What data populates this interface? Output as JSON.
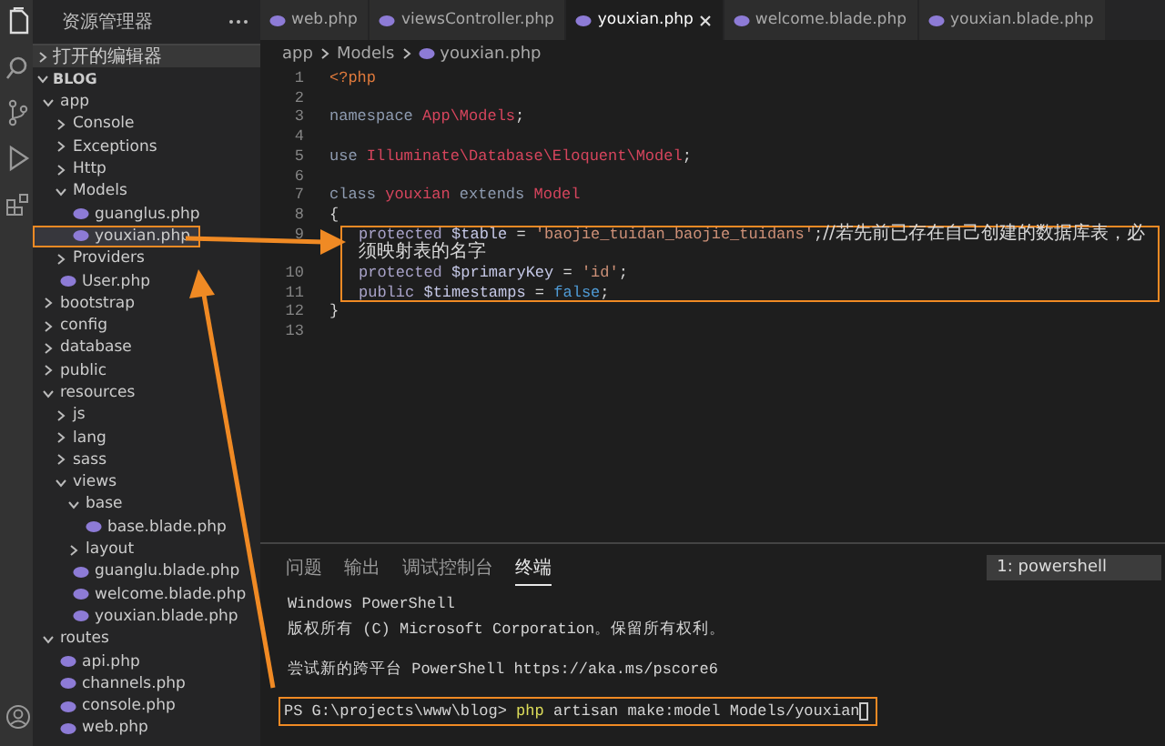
{
  "sidebar": {
    "title": "资源管理器",
    "sections": [
      {
        "label": "打开的编辑器",
        "expanded": false
      }
    ],
    "tree": {
      "label": "BLOG",
      "expanded": true,
      "children": [
        {
          "label": "app",
          "kind": "folder",
          "expanded": true,
          "selected": false,
          "highlighted": false,
          "children": [
            {
              "label": "Console",
              "kind": "folder",
              "expanded": false,
              "selected": false,
              "highlighted": false
            },
            {
              "label": "Exceptions",
              "kind": "folder",
              "expanded": false,
              "selected": false,
              "highlighted": false
            },
            {
              "label": "Http",
              "kind": "folder",
              "expanded": false,
              "selected": false,
              "highlighted": false
            },
            {
              "label": "Models",
              "kind": "folder",
              "expanded": true,
              "selected": false,
              "highlighted": false,
              "children": [
                {
                  "label": "guanglus.php",
                  "kind": "file",
                  "selected": false,
                  "highlighted": false
                },
                {
                  "label": "youxian.php",
                  "kind": "file",
                  "selected": true,
                  "highlighted": true
                }
              ]
            },
            {
              "label": "Providers",
              "kind": "folder",
              "expanded": false,
              "selected": false,
              "highlighted": false
            },
            {
              "label": "User.php",
              "kind": "file",
              "selected": false,
              "highlighted": false
            }
          ]
        },
        {
          "label": "bootstrap",
          "kind": "folder",
          "expanded": false,
          "selected": false,
          "highlighted": false
        },
        {
          "label": "config",
          "kind": "folder",
          "expanded": false,
          "selected": false,
          "highlighted": false
        },
        {
          "label": "database",
          "kind": "folder",
          "expanded": false,
          "selected": false,
          "highlighted": false
        },
        {
          "label": "public",
          "kind": "folder",
          "expanded": false,
          "selected": false,
          "highlighted": false
        },
        {
          "label": "resources",
          "kind": "folder",
          "expanded": true,
          "selected": false,
          "highlighted": false,
          "children": [
            {
              "label": "js",
              "kind": "folder",
              "expanded": false,
              "selected": false,
              "highlighted": false
            },
            {
              "label": "lang",
              "kind": "folder",
              "expanded": false,
              "selected": false,
              "highlighted": false
            },
            {
              "label": "sass",
              "kind": "folder",
              "expanded": false,
              "selected": false,
              "highlighted": false
            },
            {
              "label": "views",
              "kind": "folder",
              "expanded": true,
              "selected": false,
              "highlighted": false,
              "children": [
                {
                  "label": "base",
                  "kind": "folder",
                  "expanded": true,
                  "selected": false,
                  "highlighted": false,
                  "children": [
                    {
                      "label": "base.blade.php",
                      "kind": "file",
                      "selected": false,
                      "highlighted": false
                    }
                  ]
                },
                {
                  "label": "layout",
                  "kind": "folder",
                  "expanded": false,
                  "selected": false,
                  "highlighted": false
                },
                {
                  "label": "guanglu.blade.php",
                  "kind": "file",
                  "selected": false,
                  "highlighted": false
                },
                {
                  "label": "welcome.blade.php",
                  "kind": "file",
                  "selected": false,
                  "highlighted": false
                },
                {
                  "label": "youxian.blade.php",
                  "kind": "file",
                  "selected": false,
                  "highlighted": false
                }
              ]
            }
          ]
        },
        {
          "label": "routes",
          "kind": "folder",
          "expanded": true,
          "selected": false,
          "highlighted": false,
          "children": [
            {
              "label": "api.php",
              "kind": "file",
              "selected": false,
              "highlighted": false
            },
            {
              "label": "channels.php",
              "kind": "file",
              "selected": false,
              "highlighted": false
            },
            {
              "label": "console.php",
              "kind": "file",
              "selected": false,
              "highlighted": false
            },
            {
              "label": "web.php",
              "kind": "file",
              "selected": false,
              "highlighted": false
            }
          ]
        }
      ]
    }
  },
  "editor": {
    "tabs": [
      {
        "label": "web.php",
        "selected": false
      },
      {
        "label": "viewsController.php",
        "selected": false
      },
      {
        "label": "youxian.php",
        "selected": true
      },
      {
        "label": "welcome.blade.php",
        "selected": false
      },
      {
        "label": "youxian.blade.php",
        "selected": false
      }
    ],
    "breadcrumb": [
      "app",
      "Models",
      "youxian.php"
    ],
    "lines": [
      {
        "number": "1",
        "tokens": [
          {
            "kind": "tag",
            "text": "<?php"
          }
        ]
      },
      {
        "number": "2"
      },
      {
        "number": "3",
        "tokens": [
          {
            "kind": "keyword",
            "text": "namespace "
          },
          {
            "kind": "name",
            "text": "App\\Models"
          },
          {
            "kind": "plain",
            "text": ";"
          }
        ]
      },
      {
        "number": "4"
      },
      {
        "number": "5",
        "tokens": [
          {
            "kind": "keyword",
            "text": "use "
          },
          {
            "kind": "name",
            "text": "Illuminate\\Database\\Eloquent\\Model"
          },
          {
            "kind": "plain",
            "text": ";"
          }
        ]
      },
      {
        "number": "6"
      },
      {
        "number": "7",
        "tokens": [
          {
            "kind": "keyword",
            "text": "class "
          },
          {
            "kind": "name",
            "text": "youxian"
          },
          {
            "kind": "keyword",
            "text": " extends "
          },
          {
            "kind": "name",
            "text": "Model"
          }
        ]
      },
      {
        "number": "8",
        "tokens": [
          {
            "kind": "plain",
            "text": "{"
          }
        ]
      },
      {
        "number": "9",
        "indented": true,
        "highlighted": true,
        "tokens": [
          {
            "kind": "modifier",
            "text": "protected "
          },
          {
            "kind": "variable",
            "text": "$table"
          },
          {
            "kind": "plain",
            "text": " = "
          },
          {
            "kind": "string",
            "text": "'baojie_tuidan_baojie_tuidans'"
          },
          {
            "kind": "plain",
            "text": ";"
          },
          {
            "kind": "comment",
            "text": "//若先前已存在自己创建的数据库表，必须映射表的名字"
          }
        ]
      },
      {
        "number": "10",
        "indented": true,
        "highlighted": true,
        "tokens": [
          {
            "kind": "modifier",
            "text": "protected "
          },
          {
            "kind": "variable",
            "text": "$primaryKey"
          },
          {
            "kind": "plain",
            "text": " = "
          },
          {
            "kind": "string",
            "text": "'id'"
          },
          {
            "kind": "plain",
            "text": ";"
          }
        ]
      },
      {
        "number": "11",
        "indented": true,
        "highlighted": true,
        "tokens": [
          {
            "kind": "modifier",
            "text": "public "
          },
          {
            "kind": "variable",
            "text": "$timestamps"
          },
          {
            "kind": "plain",
            "text": " = "
          },
          {
            "kind": "constant",
            "text": "false"
          },
          {
            "kind": "plain",
            "text": ";"
          }
        ]
      },
      {
        "number": "12",
        "tokens": [
          {
            "kind": "plain",
            "text": "}"
          }
        ]
      },
      {
        "number": "13"
      }
    ]
  },
  "panel": {
    "tabs": [
      {
        "label": "问题",
        "selected": false
      },
      {
        "label": "输出",
        "selected": false
      },
      {
        "label": "调试控制台",
        "selected": false
      },
      {
        "label": "终端",
        "selected": true
      }
    ],
    "terminal_picker": "1: powershell",
    "blocks": [
      [
        {
          "highlighted": false,
          "tokens": [
            {
              "kind": "plain",
              "text": "Windows PowerShell"
            }
          ]
        },
        {
          "highlighted": false,
          "tokens": [
            {
              "kind": "plain",
              "text": "版权所有 (C) Microsoft Corporation。保留所有权利。"
            }
          ]
        }
      ],
      [
        {
          "highlighted": false,
          "tokens": [
            {
              "kind": "plain",
              "text": "尝试新的跨平台 PowerShell https://aka.ms/pscore6"
            }
          ]
        }
      ],
      [
        {
          "highlighted": true,
          "tokens": [
            {
              "kind": "plain",
              "text": "PS G:\\projects\\www\\blog> "
            },
            {
              "kind": "command",
              "text": "php"
            },
            {
              "kind": "plain",
              "text": " artisan make:model Models/youxian"
            }
          ]
        }
      ]
    ]
  }
}
